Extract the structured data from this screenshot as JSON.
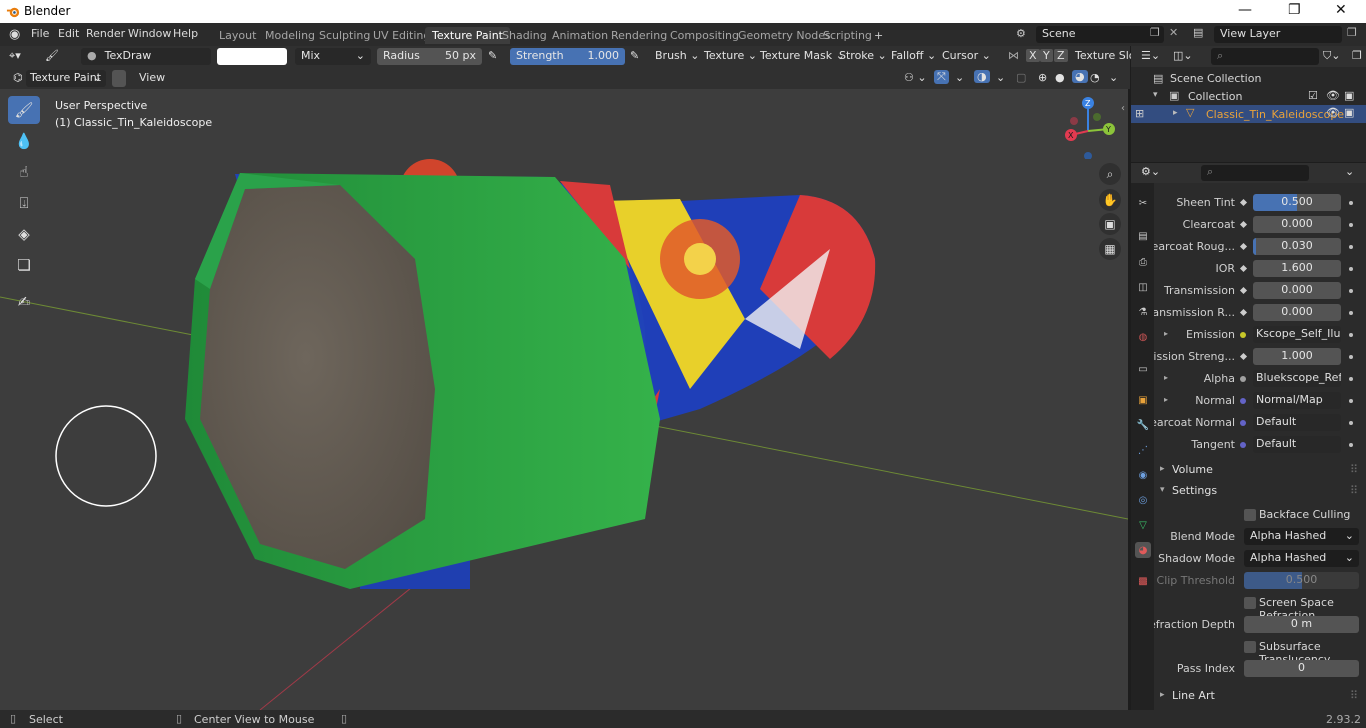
{
  "window": {
    "title": "Blender",
    "controls": [
      "—",
      "❐",
      "✕"
    ]
  },
  "menu": {
    "items": [
      "File",
      "Edit",
      "Render",
      "Window",
      "Help"
    ]
  },
  "workspaces": [
    "Layout",
    "Modeling",
    "Sculpting",
    "UV Editing",
    "Texture Paint",
    "Shading",
    "Animation",
    "Rendering",
    "Compositing",
    "Geometry Nodes",
    "Scripting"
  ],
  "active_workspace": "Texture Paint",
  "scene": {
    "scene_name": "Scene",
    "view_layer": "View Layer"
  },
  "tool_header": {
    "brush_name": "TexDraw",
    "blend": "Mix",
    "radius_label": "Radius",
    "radius_value": "50 px",
    "strength_label": "Strength",
    "strength_value": "1.000",
    "strength_fraction": 1.0,
    "dropdowns": [
      "Brush",
      "Texture",
      "Texture Mask",
      "Stroke",
      "Falloff",
      "Cursor"
    ],
    "axes": [
      "X",
      "Y",
      "Z"
    ],
    "texture_slots": "Texture Slots"
  },
  "viewport_header": {
    "mode": "Texture Paint",
    "view": "View"
  },
  "viewport": {
    "perspective": "User Perspective",
    "object": "(1) Classic_Tin_Kaleidoscope",
    "gizmo": {
      "x": "X",
      "y": "Y",
      "z": "Z"
    }
  },
  "outliner": {
    "scene_collection": "Scene Collection",
    "collection": "Collection",
    "object": "Classic_Tin_Kaleidoscope"
  },
  "properties": {
    "rows": [
      {
        "label": "Sheen Tint",
        "value": "0.500",
        "fraction": 0.5,
        "kind": "slider"
      },
      {
        "label": "Clearcoat",
        "value": "0.000",
        "fraction": 0,
        "kind": "slider"
      },
      {
        "label": "Clearcoat Roug...",
        "value": "0.030",
        "fraction": 0.03,
        "kind": "slider"
      },
      {
        "label": "IOR",
        "value": "1.600",
        "fraction": 0,
        "kind": "slider"
      },
      {
        "label": "Transmission",
        "value": "0.000",
        "fraction": 0,
        "kind": "slider"
      },
      {
        "label": "Transmission R...",
        "value": "0.000",
        "fraction": 0,
        "kind": "slider"
      },
      {
        "label": "Emission",
        "value": "Kscope_Self_Ilum.png",
        "kind": "link",
        "socket": "#c7c729",
        "expand": true
      },
      {
        "label": "Emission Streng...",
        "value": "1.000",
        "fraction": 0,
        "kind": "slider"
      },
      {
        "label": "Alpha",
        "value": "Bluekscope_Refracti...",
        "kind": "link",
        "socket": "#a1a1a1",
        "expand": true
      },
      {
        "label": "Normal",
        "value": "Normal/Map",
        "kind": "link",
        "socket": "#6363c7",
        "expand": true
      },
      {
        "label": "Clearcoat Normal",
        "value": "Default",
        "kind": "link",
        "socket": "#6363c7",
        "expand": false
      },
      {
        "label": "Tangent",
        "value": "Default",
        "kind": "link",
        "socket": "#6363c7",
        "expand": false
      }
    ],
    "sections": {
      "volume": "Volume",
      "settings": "Settings",
      "line_art": "Line Art"
    },
    "settings": {
      "backface_culling": "Backface Culling",
      "blend_mode_label": "Blend Mode",
      "blend_mode": "Alpha Hashed",
      "shadow_mode_label": "Shadow Mode",
      "shadow_mode": "Alpha Hashed",
      "clip_threshold_label": "Clip Threshold",
      "clip_threshold": "0.500",
      "clip_fraction": 0.5,
      "ssr": "Screen Space Refraction",
      "refraction_depth_label": "Refraction Depth",
      "refraction_depth": "0 m",
      "subsurface": "Subsurface Translucency",
      "pass_index_label": "Pass Index",
      "pass_index": "0"
    }
  },
  "status": {
    "select": "Select",
    "center": "Center View to Mouse",
    "version": "2.93.2"
  },
  "colors": {
    "accent": "#4772b3",
    "header": "#303030",
    "viewport": "#3d3d3d",
    "selected_row": "#334d80",
    "x_axis": "#e23a50",
    "y_axis": "#8cc43a",
    "z_axis": "#3a82e2"
  }
}
